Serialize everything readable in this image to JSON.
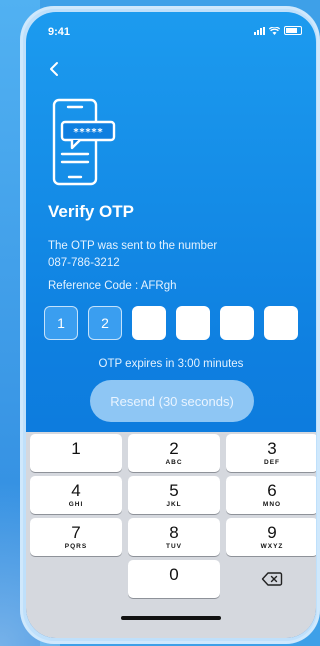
{
  "status": {
    "time": "9:41"
  },
  "otp": {
    "title": "Verify OTP",
    "sent_line": "The OTP was sent to the number",
    "phone": "087-786-3212",
    "reference": "Reference Code : AFRgh",
    "digits": [
      "1",
      "2",
      "",
      "",
      "",
      ""
    ],
    "expiry": "OTP expires in 3:00 minutes",
    "resend_label": "Resend (30 seconds)",
    "illustration_text": "*****"
  },
  "keypad": {
    "rows": [
      [
        {
          "num": "1",
          "letters": ""
        },
        {
          "num": "2",
          "letters": "ABC"
        },
        {
          "num": "3",
          "letters": "DEF"
        }
      ],
      [
        {
          "num": "4",
          "letters": "GHI"
        },
        {
          "num": "5",
          "letters": "JKL"
        },
        {
          "num": "6",
          "letters": "MNO"
        }
      ],
      [
        {
          "num": "7",
          "letters": "PQRS"
        },
        {
          "num": "8",
          "letters": "TUV"
        },
        {
          "num": "9",
          "letters": "WXYZ"
        }
      ],
      [
        {
          "num": "",
          "letters": ""
        },
        {
          "num": "0",
          "letters": ""
        },
        {
          "num": "",
          "letters": ""
        }
      ]
    ]
  },
  "colors": {
    "accent": "#0e7fe0",
    "keypad_bg": "#d5d8de"
  }
}
